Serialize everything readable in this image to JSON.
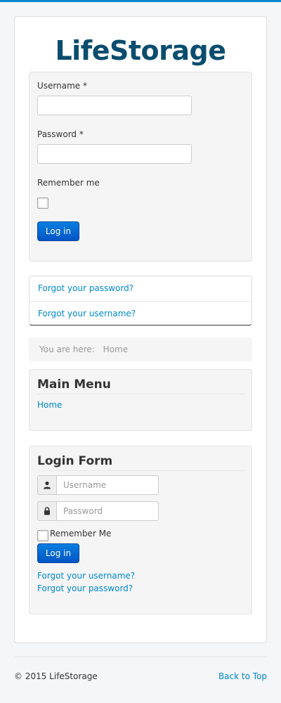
{
  "brand": "LifeStorage",
  "login": {
    "username_label": "Username *",
    "password_label": "Password *",
    "remember_label": "Remember me",
    "login_button": "Log in"
  },
  "links": {
    "forgot_password": "Forgot your password?",
    "forgot_username": "Forgot your username?"
  },
  "breadcrumb": {
    "prefix": "You are here:",
    "current": "Home"
  },
  "main_menu": {
    "title": "Main Menu",
    "items": [
      "Home"
    ]
  },
  "login_form": {
    "title": "Login Form",
    "username_placeholder": "Username",
    "password_placeholder": "Password",
    "remember_label": "Remember Me",
    "login_button": "Log in",
    "forgot_username": "Forgot your username?",
    "forgot_password": "Forgot your password?"
  },
  "footer": {
    "copyright": "© 2015 LifeStorage",
    "back_to_top": "Back to Top"
  },
  "colors": {
    "accent": "#0088cc",
    "brand": "#0a4d6e",
    "button": "#0066cc"
  }
}
